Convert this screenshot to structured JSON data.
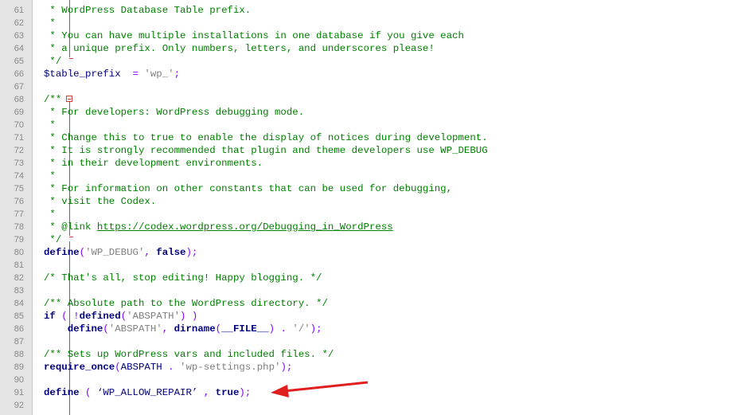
{
  "editor": {
    "lines": [
      {
        "n": "61",
        "segs": [
          {
            "t": " * WordPress Database Table prefix.",
            "c": "c-comment"
          }
        ]
      },
      {
        "n": "62",
        "segs": [
          {
            "t": " *",
            "c": "c-comment"
          }
        ]
      },
      {
        "n": "63",
        "segs": [
          {
            "t": " * You can have multiple installations in one database if you give each",
            "c": "c-comment"
          }
        ]
      },
      {
        "n": "64",
        "segs": [
          {
            "t": " * a unique prefix. Only numbers, letters, and underscores please!",
            "c": "c-comment"
          }
        ]
      },
      {
        "n": "65",
        "segs": [
          {
            "t": " */",
            "c": "c-comment"
          }
        ]
      },
      {
        "n": "66",
        "segs": [
          {
            "t": "$table_prefix",
            "c": "c-var"
          },
          {
            "t": "  = ",
            "c": "c-op"
          },
          {
            "t": "'wp_'",
            "c": "c-str"
          },
          {
            "t": ";",
            "c": "c-op"
          }
        ]
      },
      {
        "n": "67",
        "segs": []
      },
      {
        "n": "68",
        "segs": [
          {
            "t": "/**",
            "c": "c-comment"
          }
        ]
      },
      {
        "n": "69",
        "segs": [
          {
            "t": " * For developers: WordPress debugging mode.",
            "c": "c-comment"
          }
        ]
      },
      {
        "n": "70",
        "segs": [
          {
            "t": " *",
            "c": "c-comment"
          }
        ]
      },
      {
        "n": "71",
        "segs": [
          {
            "t": " * Change this to true to enable the display of notices during development.",
            "c": "c-comment"
          }
        ]
      },
      {
        "n": "72",
        "segs": [
          {
            "t": " * It is strongly recommended that plugin and theme developers use WP_DEBUG",
            "c": "c-comment"
          }
        ]
      },
      {
        "n": "73",
        "segs": [
          {
            "t": " * in their development environments.",
            "c": "c-comment"
          }
        ]
      },
      {
        "n": "74",
        "segs": [
          {
            "t": " *",
            "c": "c-comment"
          }
        ]
      },
      {
        "n": "75",
        "segs": [
          {
            "t": " * For information on other constants that can be used for debugging,",
            "c": "c-comment"
          }
        ]
      },
      {
        "n": "76",
        "segs": [
          {
            "t": " * visit the Codex.",
            "c": "c-comment"
          }
        ]
      },
      {
        "n": "77",
        "segs": [
          {
            "t": " *",
            "c": "c-comment"
          }
        ]
      },
      {
        "n": "78",
        "segs": [
          {
            "t": " * @link ",
            "c": "c-comment"
          },
          {
            "t": "https://codex.wordpress.org/Debugging_in_WordPress",
            "c": "c-link"
          }
        ]
      },
      {
        "n": "79",
        "segs": [
          {
            "t": " */",
            "c": "c-comment"
          }
        ]
      },
      {
        "n": "80",
        "segs": [
          {
            "t": "define",
            "c": "c-kw"
          },
          {
            "t": "(",
            "c": "c-op"
          },
          {
            "t": "'WP_DEBUG'",
            "c": "c-str"
          },
          {
            "t": ", ",
            "c": "c-op"
          },
          {
            "t": "false",
            "c": "c-kw"
          },
          {
            "t": ");",
            "c": "c-op"
          }
        ]
      },
      {
        "n": "81",
        "segs": []
      },
      {
        "n": "82",
        "segs": [
          {
            "t": "/* That's all, stop editing! Happy blogging. */",
            "c": "c-comment"
          }
        ]
      },
      {
        "n": "83",
        "segs": []
      },
      {
        "n": "84",
        "segs": [
          {
            "t": "/** Absolute path to the WordPress directory. */",
            "c": "c-comment"
          }
        ]
      },
      {
        "n": "85",
        "segs": [
          {
            "t": "if",
            "c": "c-kw"
          },
          {
            "t": " ( !",
            "c": "c-op"
          },
          {
            "t": "defined",
            "c": "c-kw"
          },
          {
            "t": "(",
            "c": "c-op"
          },
          {
            "t": "'ABSPATH'",
            "c": "c-str"
          },
          {
            "t": ") )",
            "c": "c-op"
          }
        ]
      },
      {
        "n": "86",
        "segs": [
          {
            "t": "    ",
            "c": "c-op"
          },
          {
            "t": "define",
            "c": "c-kw"
          },
          {
            "t": "(",
            "c": "c-op"
          },
          {
            "t": "'ABSPATH'",
            "c": "c-str"
          },
          {
            "t": ", ",
            "c": "c-op"
          },
          {
            "t": "dirname",
            "c": "c-kw"
          },
          {
            "t": "(",
            "c": "c-op"
          },
          {
            "t": "__FILE__",
            "c": "c-kw"
          },
          {
            "t": ") . ",
            "c": "c-op"
          },
          {
            "t": "'/'",
            "c": "c-str"
          },
          {
            "t": ");",
            "c": "c-op"
          }
        ]
      },
      {
        "n": "87",
        "segs": []
      },
      {
        "n": "88",
        "segs": [
          {
            "t": "/** Sets up WordPress vars and included files. */",
            "c": "c-comment"
          }
        ]
      },
      {
        "n": "89",
        "segs": [
          {
            "t": "require_once",
            "c": "c-kw"
          },
          {
            "t": "(",
            "c": "c-op"
          },
          {
            "t": "ABSPATH",
            "c": "c-const"
          },
          {
            "t": " . ",
            "c": "c-op"
          },
          {
            "t": "'wp-settings.php'",
            "c": "c-str"
          },
          {
            "t": ");",
            "c": "c-op"
          }
        ]
      },
      {
        "n": "90",
        "segs": []
      },
      {
        "n": "91",
        "segs": [
          {
            "t": "define",
            "c": "c-kw"
          },
          {
            "t": " ( ",
            "c": "c-op"
          },
          {
            "t": "‘WP_ALLOW_REPAIR’",
            "c": "c-const"
          },
          {
            "t": " , ",
            "c": "c-op"
          },
          {
            "t": "true",
            "c": "c-kw"
          },
          {
            "t": ");",
            "c": "c-op"
          }
        ]
      },
      {
        "n": "92",
        "segs": []
      }
    ]
  },
  "colors": {
    "comment": "#008000",
    "keyword": "#000080",
    "operator": "#8000ff",
    "string": "#808080",
    "fold_marker": "#d23b3b",
    "annotation_arrow": "#e02020",
    "gutter": "#e4e4e4"
  },
  "annotation": {
    "icon": "red-arrow-icon",
    "points_to_line": "91"
  }
}
